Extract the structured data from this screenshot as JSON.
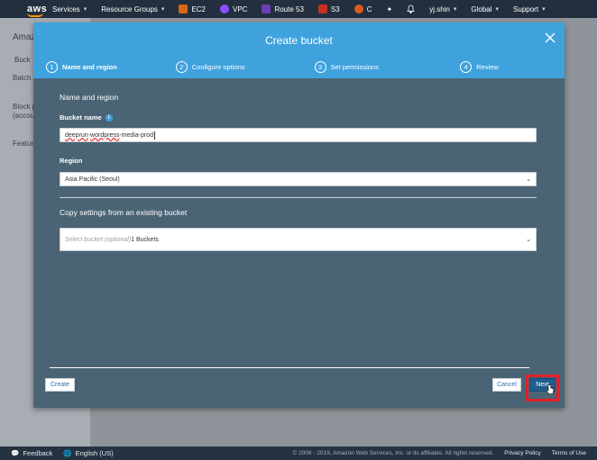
{
  "topnav": {
    "logo": "aws",
    "services": "Services",
    "resource_groups": "Resource Groups",
    "shortcuts": [
      {
        "label": "EC2",
        "icon": "ec2-icon"
      },
      {
        "label": "VPC",
        "icon": "vpc-icon"
      },
      {
        "label": "Route 53",
        "icon": "route53-icon"
      },
      {
        "label": "S3",
        "icon": "s3-icon"
      },
      {
        "label": "C",
        "icon": "cloudformation-icon"
      }
    ],
    "user": "yj.shin",
    "region": "Global",
    "support": "Support"
  },
  "sidebar": {
    "title": "Amaz",
    "items": [
      "Buck",
      "Batch",
      "Block p",
      "(accou",
      "Featur"
    ]
  },
  "modal": {
    "title": "Create bucket",
    "steps": [
      {
        "num": "1",
        "label": "Name and region"
      },
      {
        "num": "2",
        "label": "Configure options"
      },
      {
        "num": "3",
        "label": "Set permissions"
      },
      {
        "num": "4",
        "label": "Review"
      }
    ],
    "section_title": "Name and region",
    "bucket_name_label": "Bucket name",
    "bucket_name_value_parts": [
      "deeprun",
      "-",
      "wordpress",
      "-media-prod"
    ],
    "region_label": "Region",
    "region_value": "Asia Pacific (Seoul)",
    "copy_settings_title": "Copy settings from an existing bucket",
    "copy_select_placeholder": "Select bucket (optional)",
    "copy_select_count": "1 Buckets",
    "create_button": "Create",
    "cancel_button": "Cancel",
    "next_button": "Next"
  },
  "footer": {
    "feedback": "Feedback",
    "language": "English (US)",
    "copyright": "© 2008 - 2019, Amazon Web Services, Inc. or its affiliates. All rights reserved.",
    "privacy": "Privacy Policy",
    "terms": "Terms of Use"
  },
  "colors": {
    "nav": "#232f3e",
    "modal_header": "#3fa2dd",
    "modal_body": "#4b6475",
    "next_button": "#1f5d8f",
    "highlight": "#e0202a"
  }
}
